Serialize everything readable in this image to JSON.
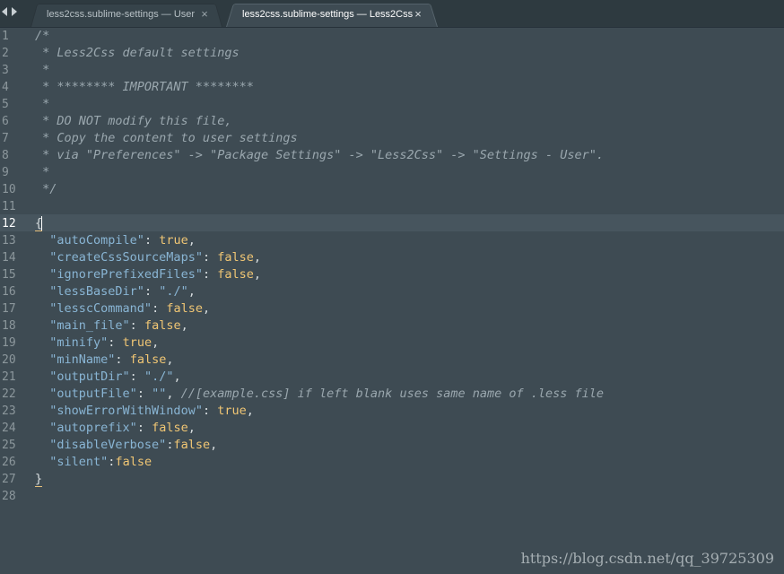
{
  "tabs": [
    {
      "label": "less2css.sublime-settings — User",
      "close": "×",
      "active": false
    },
    {
      "label": "less2css.sublime-settings — Less2Css",
      "close": "×",
      "active": true
    }
  ],
  "editor": {
    "current_line": 12,
    "line_numbers": [
      "1",
      "2",
      "3",
      "4",
      "5",
      "6",
      "7",
      "8",
      "9",
      "10",
      "11",
      "12",
      "13",
      "14",
      "15",
      "16",
      "17",
      "18",
      "19",
      "20",
      "21",
      "22",
      "23",
      "24",
      "25",
      "26",
      "27",
      "28"
    ],
    "lines": [
      [
        {
          "t": "/*",
          "k": "comment"
        }
      ],
      [
        {
          "t": " * Less2Css default settings",
          "k": "comment"
        }
      ],
      [
        {
          "t": " *",
          "k": "comment"
        }
      ],
      [
        {
          "t": " * ******** IMPORTANT ********",
          "k": "comment"
        }
      ],
      [
        {
          "t": " *",
          "k": "comment"
        }
      ],
      [
        {
          "t": " * DO NOT modify this file,",
          "k": "comment"
        }
      ],
      [
        {
          "t": " * Copy the content to user settings",
          "k": "comment"
        }
      ],
      [
        {
          "t": " * via \"Preferences\" -> \"Package Settings\" -> \"Less2Css\" -> \"Settings - User\".",
          "k": "comment"
        }
      ],
      [
        {
          "t": " *",
          "k": "comment"
        }
      ],
      [
        {
          "t": " */",
          "k": "comment"
        }
      ],
      [],
      [
        {
          "t": "{",
          "k": "brace-matched"
        }
      ],
      [
        {
          "t": "  ",
          "k": "punct"
        },
        {
          "t": "\"autoCompile\"",
          "k": "string"
        },
        {
          "t": ": ",
          "k": "punct"
        },
        {
          "t": "true",
          "k": "keyword"
        },
        {
          "t": ",",
          "k": "punct"
        }
      ],
      [
        {
          "t": "  ",
          "k": "punct"
        },
        {
          "t": "\"createCssSourceMaps\"",
          "k": "string"
        },
        {
          "t": ": ",
          "k": "punct"
        },
        {
          "t": "false",
          "k": "keyword"
        },
        {
          "t": ",",
          "k": "punct"
        }
      ],
      [
        {
          "t": "  ",
          "k": "punct"
        },
        {
          "t": "\"ignorePrefixedFiles\"",
          "k": "string"
        },
        {
          "t": ": ",
          "k": "punct"
        },
        {
          "t": "false",
          "k": "keyword"
        },
        {
          "t": ",",
          "k": "punct"
        }
      ],
      [
        {
          "t": "  ",
          "k": "punct"
        },
        {
          "t": "\"lessBaseDir\"",
          "k": "string"
        },
        {
          "t": ": ",
          "k": "punct"
        },
        {
          "t": "\"./\"",
          "k": "string"
        },
        {
          "t": ",",
          "k": "punct"
        }
      ],
      [
        {
          "t": "  ",
          "k": "punct"
        },
        {
          "t": "\"lesscCommand\"",
          "k": "string"
        },
        {
          "t": ": ",
          "k": "punct"
        },
        {
          "t": "false",
          "k": "keyword"
        },
        {
          "t": ",",
          "k": "punct"
        }
      ],
      [
        {
          "t": "  ",
          "k": "punct"
        },
        {
          "t": "\"main_file\"",
          "k": "string"
        },
        {
          "t": ": ",
          "k": "punct"
        },
        {
          "t": "false",
          "k": "keyword"
        },
        {
          "t": ",",
          "k": "punct"
        }
      ],
      [
        {
          "t": "  ",
          "k": "punct"
        },
        {
          "t": "\"minify\"",
          "k": "string"
        },
        {
          "t": ": ",
          "k": "punct"
        },
        {
          "t": "true",
          "k": "keyword"
        },
        {
          "t": ",",
          "k": "punct"
        }
      ],
      [
        {
          "t": "  ",
          "k": "punct"
        },
        {
          "t": "\"minName\"",
          "k": "string"
        },
        {
          "t": ": ",
          "k": "punct"
        },
        {
          "t": "false",
          "k": "keyword"
        },
        {
          "t": ",",
          "k": "punct"
        }
      ],
      [
        {
          "t": "  ",
          "k": "punct"
        },
        {
          "t": "\"outputDir\"",
          "k": "string"
        },
        {
          "t": ": ",
          "k": "punct"
        },
        {
          "t": "\"./\"",
          "k": "string"
        },
        {
          "t": ",",
          "k": "punct"
        }
      ],
      [
        {
          "t": "  ",
          "k": "punct"
        },
        {
          "t": "\"outputFile\"",
          "k": "string"
        },
        {
          "t": ": ",
          "k": "punct"
        },
        {
          "t": "\"\"",
          "k": "string"
        },
        {
          "t": ", ",
          "k": "punct"
        },
        {
          "t": "//[example.css] if left blank uses same name of .less file",
          "k": "comment"
        }
      ],
      [
        {
          "t": "  ",
          "k": "punct"
        },
        {
          "t": "\"showErrorWithWindow\"",
          "k": "string"
        },
        {
          "t": ": ",
          "k": "punct"
        },
        {
          "t": "true",
          "k": "keyword"
        },
        {
          "t": ",",
          "k": "punct"
        }
      ],
      [
        {
          "t": "  ",
          "k": "punct"
        },
        {
          "t": "\"autoprefix\"",
          "k": "string"
        },
        {
          "t": ": ",
          "k": "punct"
        },
        {
          "t": "false",
          "k": "keyword"
        },
        {
          "t": ",",
          "k": "punct"
        }
      ],
      [
        {
          "t": "  ",
          "k": "punct"
        },
        {
          "t": "\"disableVerbose\"",
          "k": "string"
        },
        {
          "t": ":",
          "k": "punct"
        },
        {
          "t": "false",
          "k": "keyword"
        },
        {
          "t": ",",
          "k": "punct"
        }
      ],
      [
        {
          "t": "  ",
          "k": "punct"
        },
        {
          "t": "\"silent\"",
          "k": "string"
        },
        {
          "t": ":",
          "k": "punct"
        },
        {
          "t": "false",
          "k": "keyword"
        }
      ],
      [
        {
          "t": "}",
          "k": "brace-matched"
        }
      ],
      []
    ]
  },
  "watermark": "https://blog.csdn.net/qq_39725309",
  "colors": {
    "background": "#3e4b53",
    "tabbar": "#2e3a40",
    "string": "#89b5d4",
    "keyword": "#f0c674",
    "comment": "#9aa7ae"
  }
}
